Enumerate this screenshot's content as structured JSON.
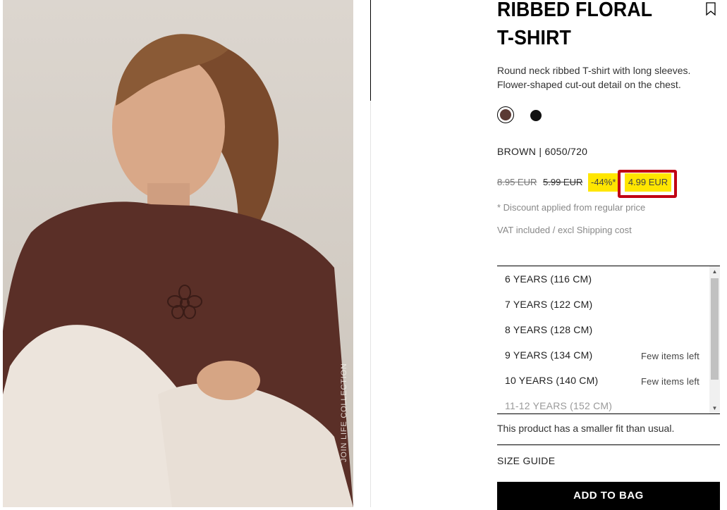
{
  "product": {
    "title": "RIBBED FLORAL T-SHIRT",
    "description": "Round neck ribbed T-shirt with long sleeves. Flower-shaped cut-out detail on the chest.",
    "color_label": "BROWN | 6050/720",
    "colors": [
      {
        "name": "brown",
        "hex": "#5b3a33",
        "selected": true
      },
      {
        "name": "black",
        "hex": "#111111",
        "selected": false
      }
    ],
    "prices": {
      "original": "8.95 EUR",
      "previous": "5.99 EUR",
      "discount": "-44%*",
      "final": "4.99 EUR"
    },
    "discount_note": "* Discount applied from regular price",
    "vat_note": "VAT included / excl Shipping cost",
    "sizes": [
      {
        "label": "6 YEARS (116 CM)",
        "stock": ""
      },
      {
        "label": "7 YEARS (122 CM)",
        "stock": ""
      },
      {
        "label": "8 YEARS (128 CM)",
        "stock": ""
      },
      {
        "label": "9 YEARS (134 CM)",
        "stock": "Few items left"
      },
      {
        "label": "10 YEARS (140 CM)",
        "stock": "Few items left"
      },
      {
        "label": "11-12 YEARS (152 CM)",
        "stock": ""
      }
    ],
    "fit_note": "This product has a smaller fit than usual.",
    "size_guide": "SIZE GUIDE",
    "add_to_bag": "ADD TO BAG"
  },
  "image": {
    "vertical_caption": "JOIN LIFE COLLECTION"
  },
  "colors": {
    "highlight": "#ffe600",
    "annotation_box": "#c10013",
    "brand_black": "#000000"
  },
  "icons": {
    "bookmark": "bookmark-icon",
    "scroll_up": "triangle-up",
    "scroll_down": "triangle-down"
  }
}
